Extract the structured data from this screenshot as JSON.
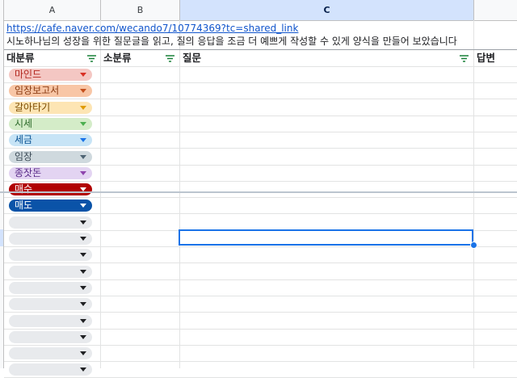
{
  "columns": [
    "A",
    "B",
    "C",
    ""
  ],
  "row1": {
    "link": "https://cafe.naver.com/wecando7/10774369?tc=shared_link"
  },
  "row2": {
    "note": "시노하나님의 성장을 위한 질문글을 읽고, 질의 응답을 조금 더 예쁘게 작성할 수 있게 양식을 만들어 보았습니다"
  },
  "headers": {
    "major": "대분류",
    "minor": "소분류",
    "question": "질문",
    "answer": "답변"
  },
  "categories": [
    {
      "label": "마인드",
      "bg": "#f4c7c3",
      "fg": "#b3261e",
      "arrow": "#d93025"
    },
    {
      "label": "임장보고서",
      "bg": "#f8c6a6",
      "fg": "#8a3b12",
      "arrow": "#c5501d"
    },
    {
      "label": "갈아타기",
      "bg": "#fde5b4",
      "fg": "#7a4b00",
      "arrow": "#e09b00"
    },
    {
      "label": "시세",
      "bg": "#d4ecc8",
      "fg": "#2e6b2b",
      "arrow": "#4caf50"
    },
    {
      "label": "세금",
      "bg": "#c7e4f6",
      "fg": "#0b5394",
      "arrow": "#1a73e8"
    },
    {
      "label": "임장",
      "bg": "#cfd9de",
      "fg": "#3c4b57",
      "arrow": "#4f6474"
    },
    {
      "label": "종잣돈",
      "bg": "#e3d4f2",
      "fg": "#5b2c8a",
      "arrow": "#8e44ad"
    },
    {
      "label": "매수",
      "bg": "#b10202",
      "fg": "#ffffff",
      "arrow": "#ffffff"
    },
    {
      "label": "매도",
      "bg": "#0a53a8",
      "fg": "#ffffff",
      "arrow": "#ffffff"
    }
  ],
  "empty_chip_count": 10,
  "colors": {
    "chip_empty": "#e8eaed",
    "selection": "#1a73e8",
    "link": "#1155cc"
  }
}
